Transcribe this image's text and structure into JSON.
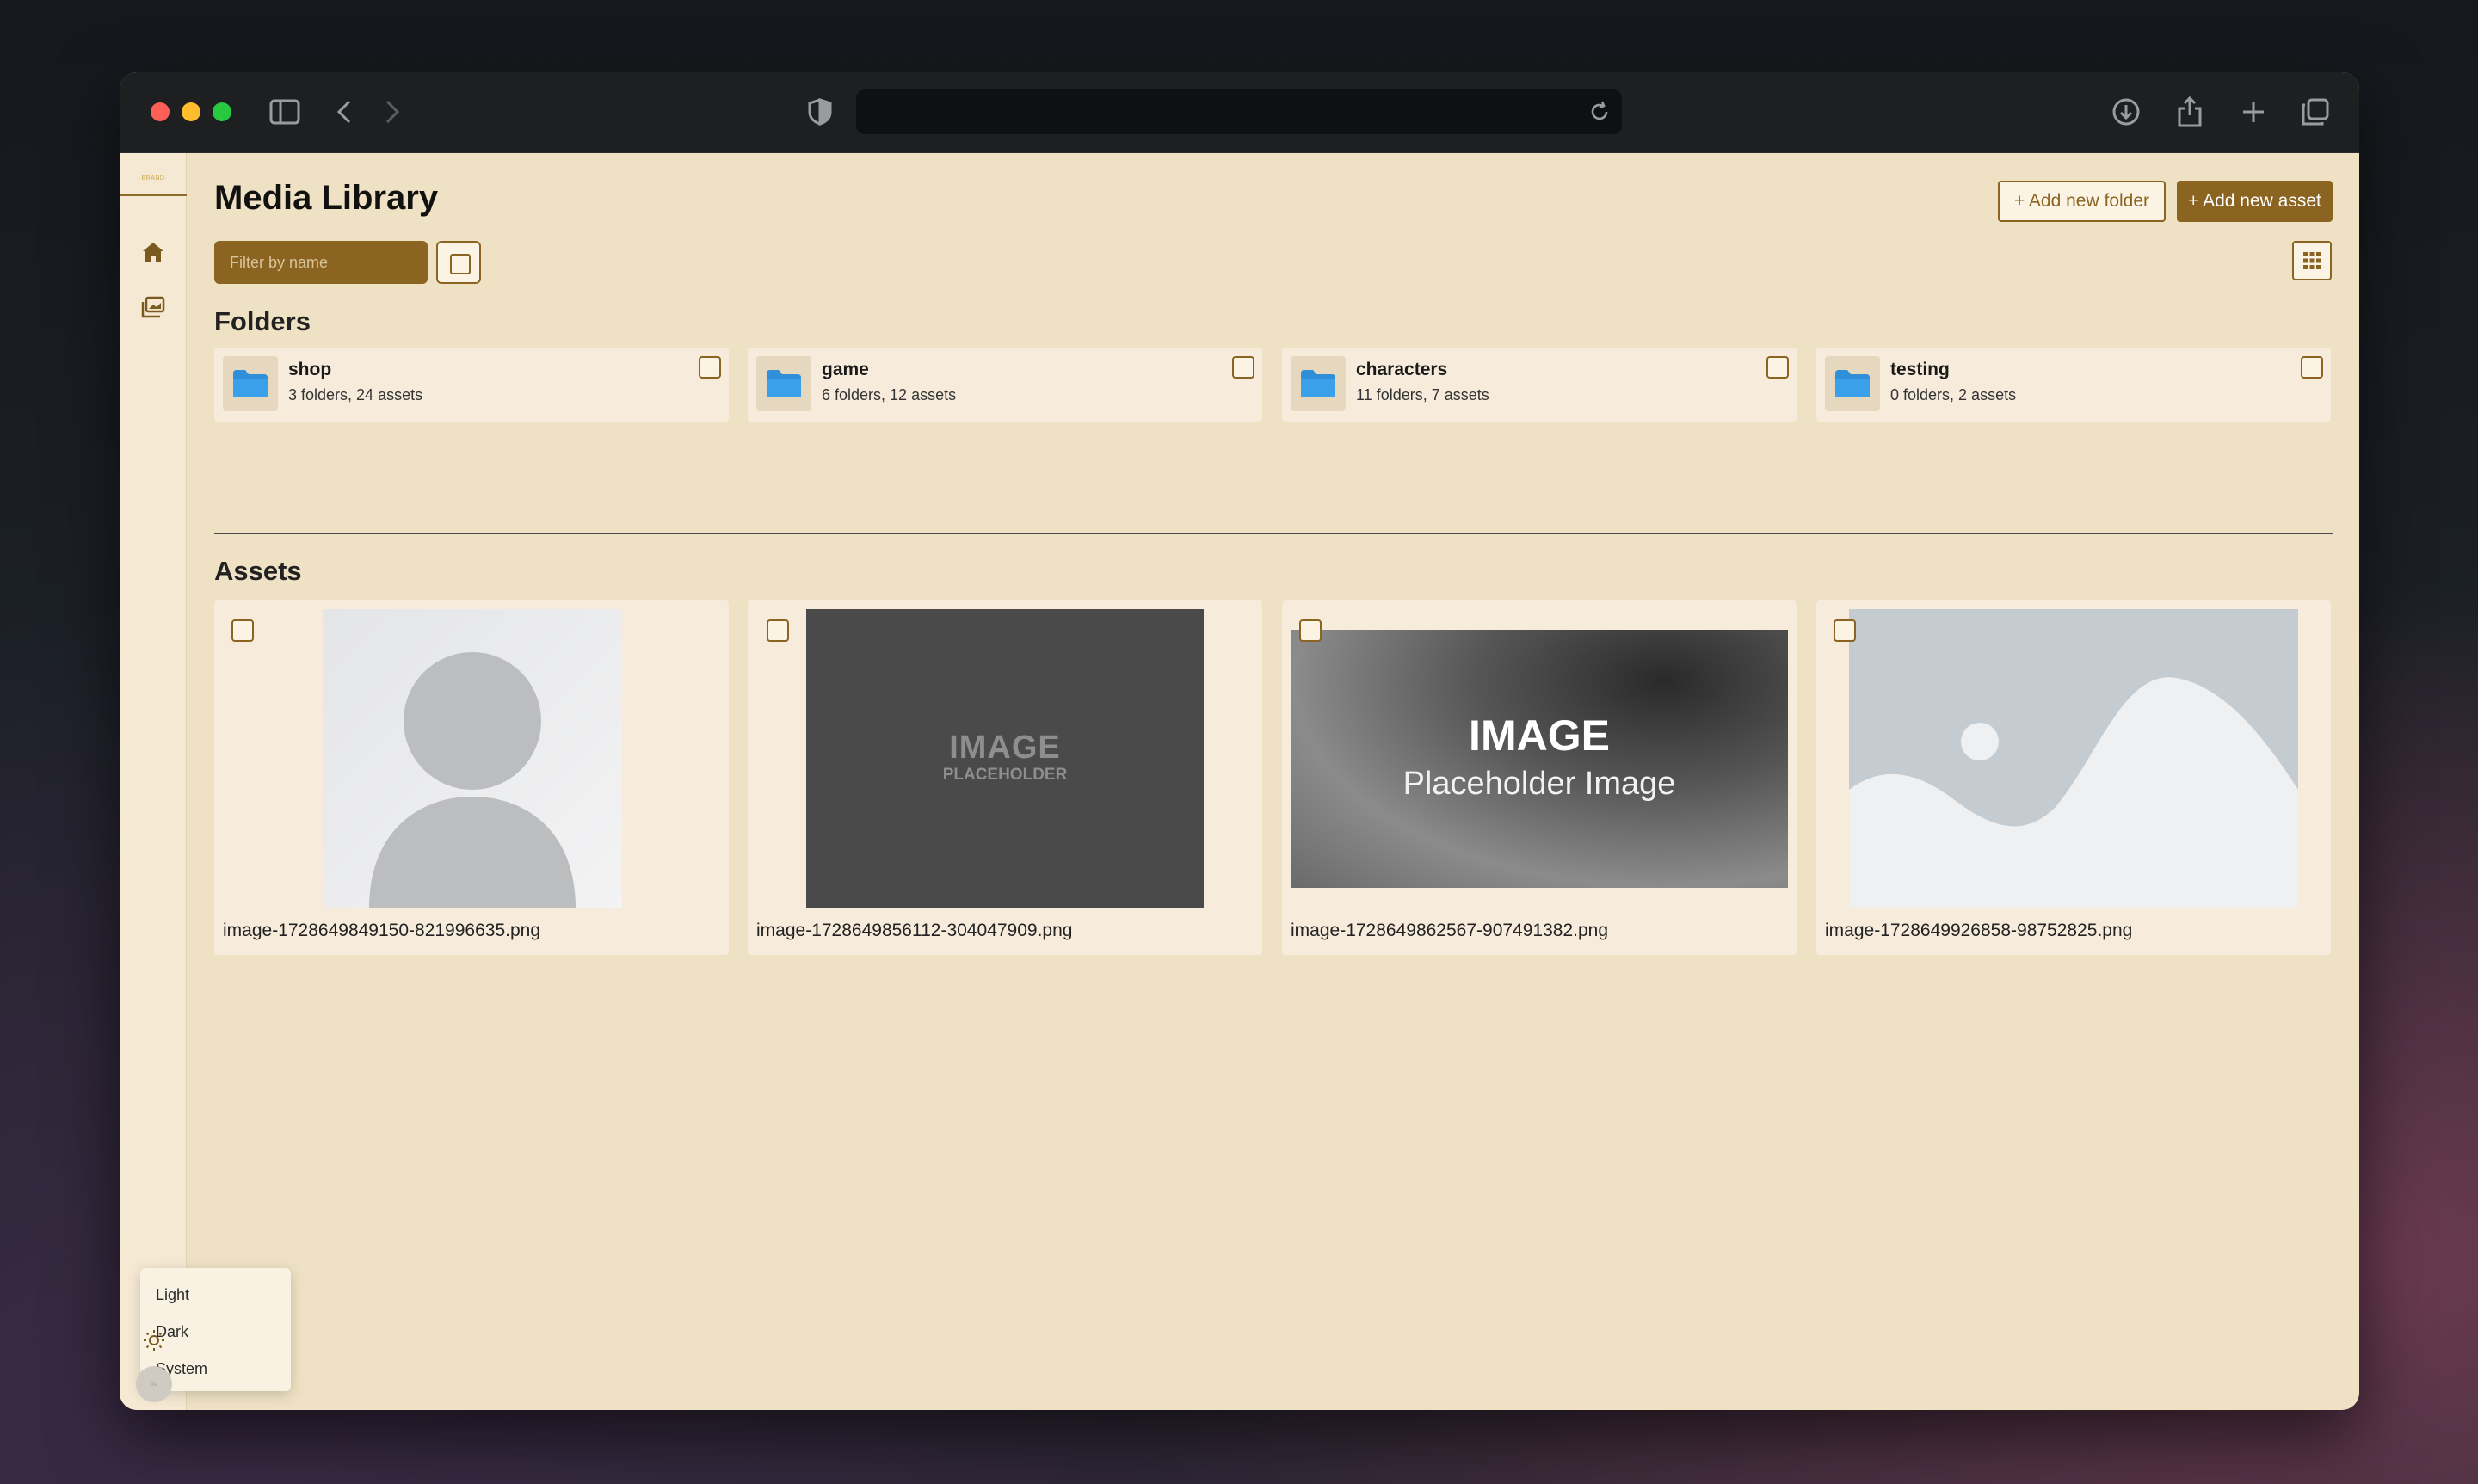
{
  "browser": {
    "url": "",
    "icons": [
      "sidebar-icon",
      "back-icon",
      "forward-icon",
      "shield-icon",
      "reload-icon",
      "download-icon",
      "share-icon",
      "new-tab-icon",
      "tabs-overview-icon"
    ]
  },
  "sidebar": {
    "logo_text": "·BRAND·",
    "items": [
      {
        "name": "home",
        "icon": "home-icon"
      },
      {
        "name": "media",
        "icon": "images-icon"
      }
    ],
    "avatar_text": "AV",
    "theme_menu": [
      "Light",
      "Dark",
      "System"
    ]
  },
  "header": {
    "title": "Media Library",
    "add_folder_label": "+ Add new folder",
    "add_asset_label": "+ Add new asset"
  },
  "filter": {
    "placeholder": "Filter by name"
  },
  "folders_section": {
    "title": "Folders",
    "items": [
      {
        "name": "shop",
        "meta": "3 folders, 24 assets"
      },
      {
        "name": "game",
        "meta": "6 folders, 12 assets"
      },
      {
        "name": "characters",
        "meta": "11 folders, 7 assets"
      },
      {
        "name": "testing",
        "meta": "0 folders, 2 assets"
      }
    ]
  },
  "assets_section": {
    "title": "Assets",
    "items": [
      {
        "filename": "image-1728649849150-821996635.png"
      },
      {
        "filename": "image-1728649856112-304047909.png",
        "thumb_line1": "IMAGE",
        "thumb_line2": "PLACEHOLDER"
      },
      {
        "filename": "image-1728649862567-907491382.png",
        "thumb_line1": "IMAGE",
        "thumb_line2": "Placeholder Image"
      },
      {
        "filename": "image-1728649926858-98752825.png"
      }
    ]
  },
  "colors": {
    "accent": "#8a6420",
    "background": "#efe1c3",
    "card": "#f7ecdb",
    "folder_blue": "#2f8fd8"
  }
}
